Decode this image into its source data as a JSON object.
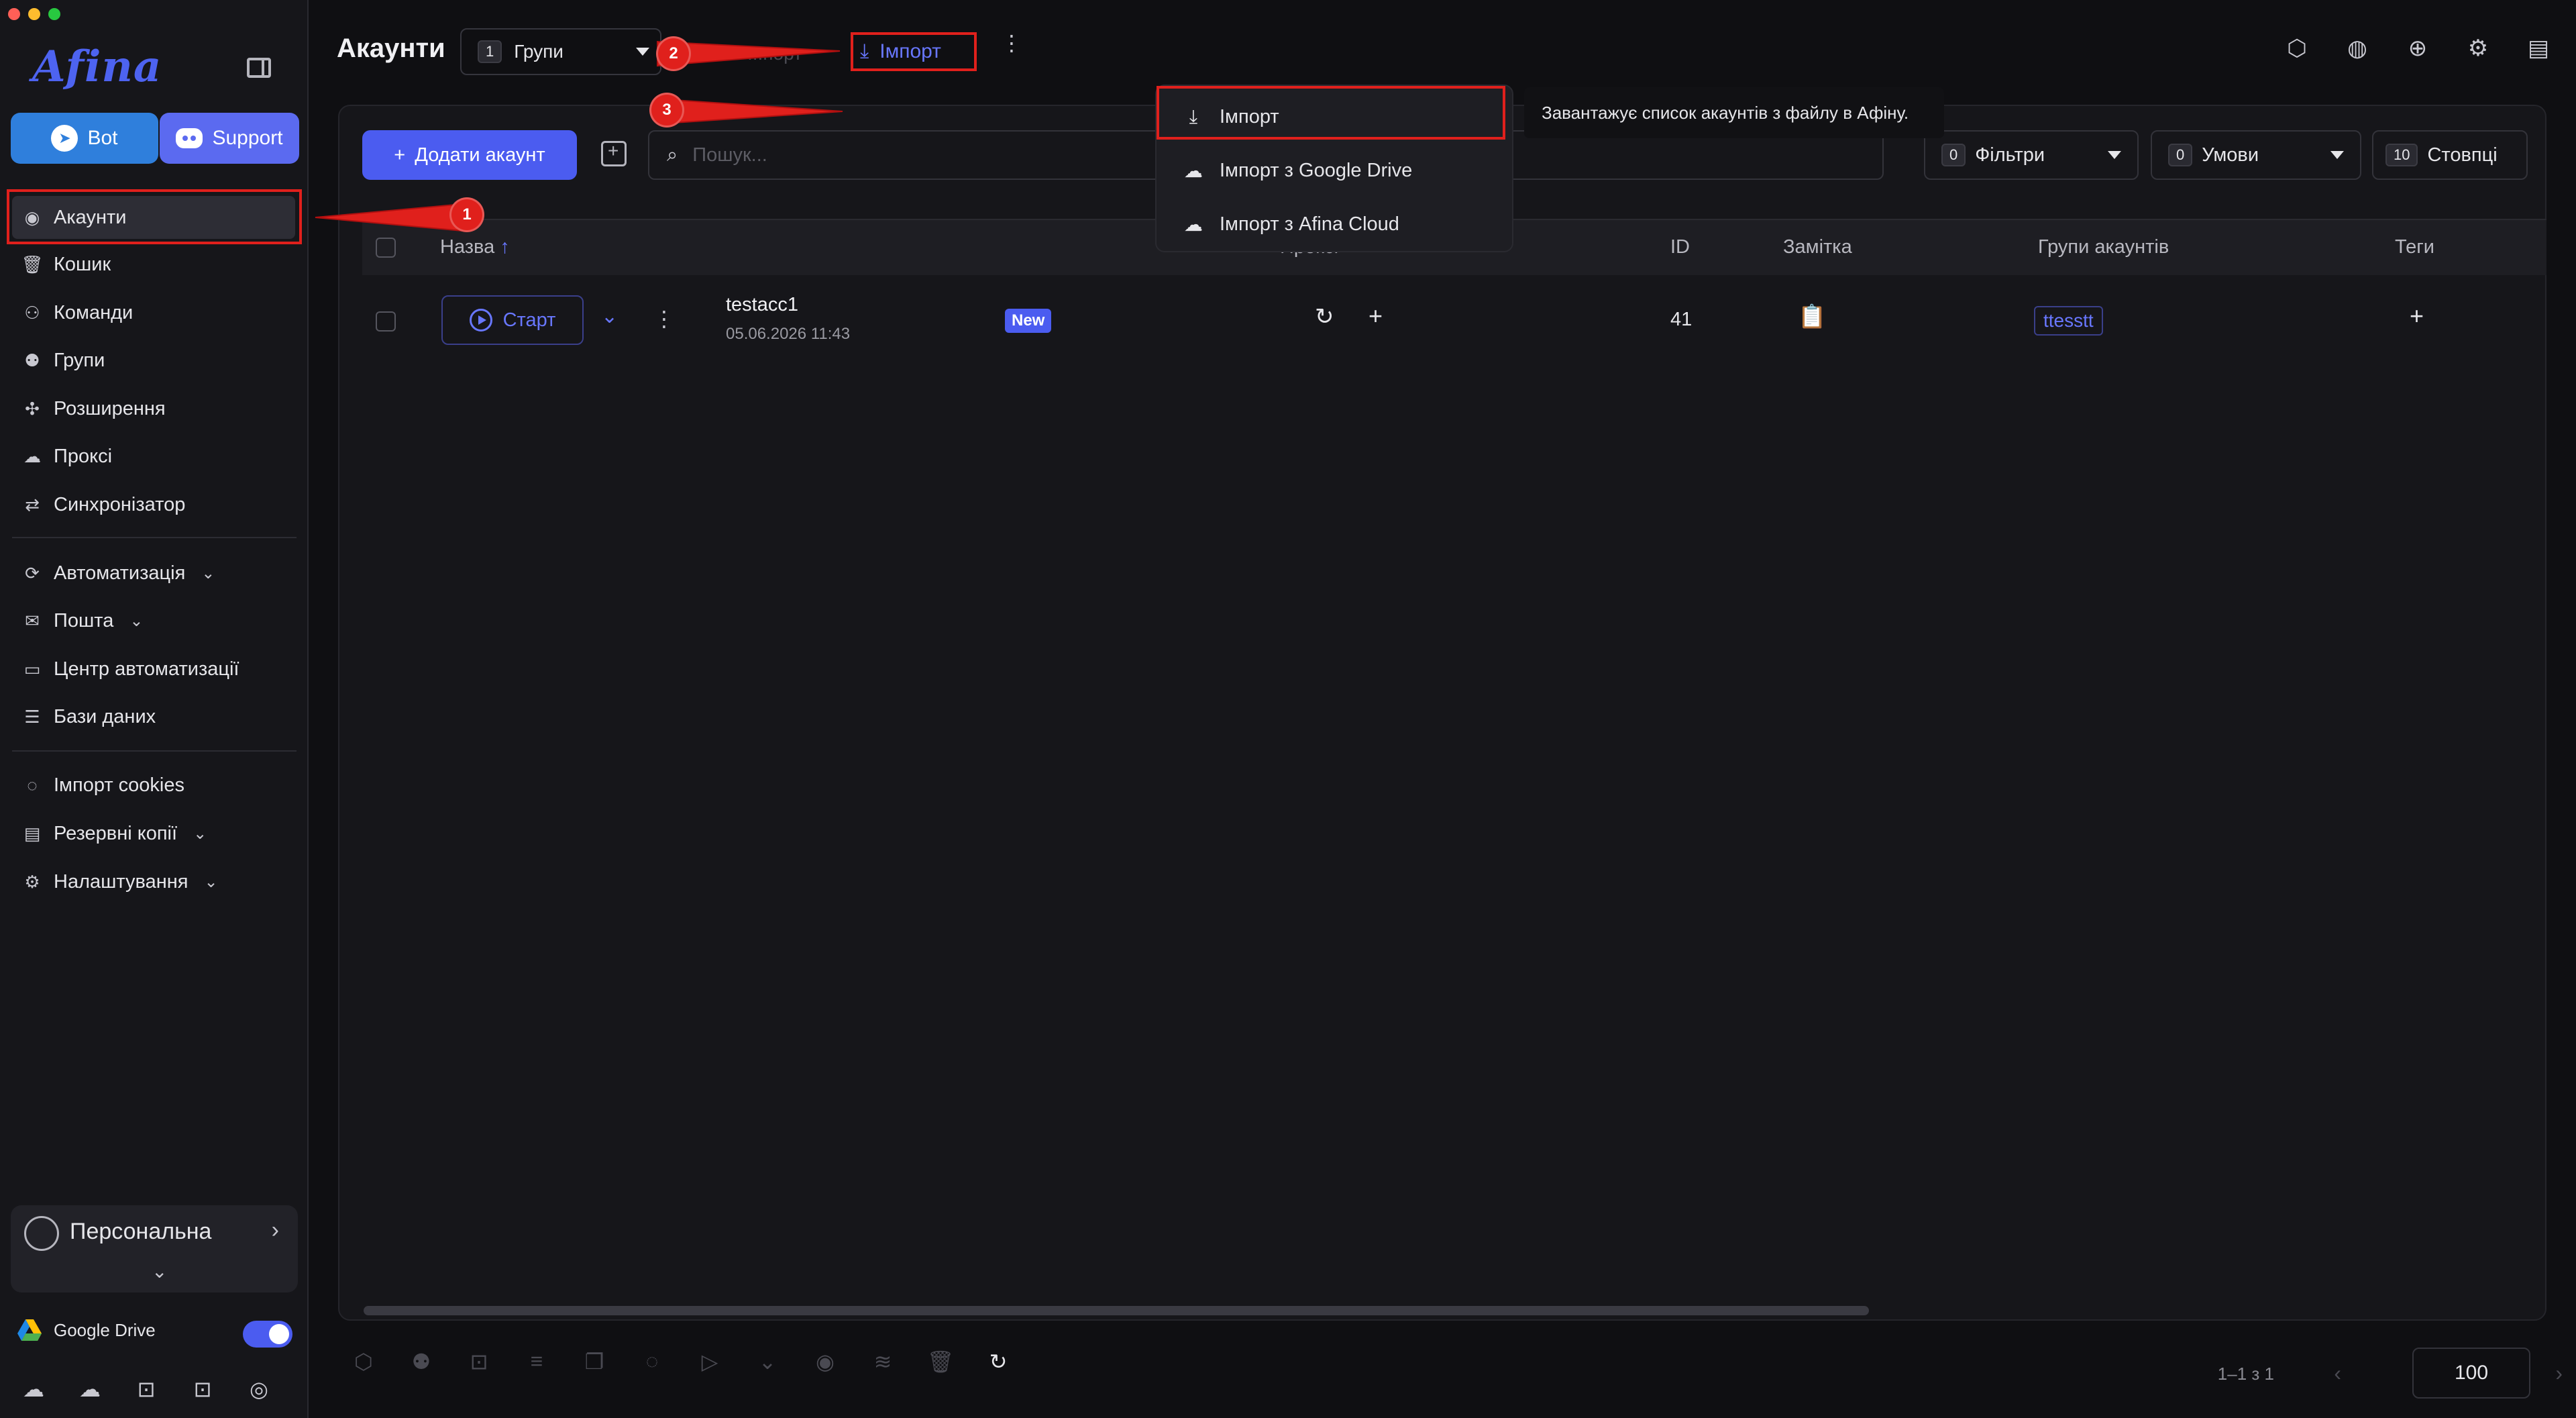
{
  "sidebar": {
    "brand": "Afina",
    "bot_label": "Bot",
    "support_label": "Support",
    "items": [
      {
        "label": "Акаунти"
      },
      {
        "label": "Кошик"
      },
      {
        "label": "Команди"
      },
      {
        "label": "Групи"
      },
      {
        "label": "Розширення"
      },
      {
        "label": "Проксі"
      },
      {
        "label": "Синхронізатор"
      },
      {
        "label": "Автоматизація"
      },
      {
        "label": "Пошта"
      },
      {
        "label": "Центр автоматизації"
      },
      {
        "label": "Бази даних"
      },
      {
        "label": "Імпорт cookies"
      },
      {
        "label": "Резервні копії"
      },
      {
        "label": "Налаштування"
      }
    ],
    "profile_name": "Персональна",
    "gdrive_label": "Google Drive",
    "gdrive_enabled": true
  },
  "header": {
    "title": "Акаунти",
    "groups_count": "1",
    "groups_label": "Групи",
    "ghost_label": "...порт",
    "import_label": "Імпорт"
  },
  "toolbar": {
    "add_label": "Додати акаунт",
    "search_placeholder": "Пошук...",
    "filters_count": "0",
    "filters_label": "Фільтри",
    "conditions_count": "0",
    "conditions_label": "Умови",
    "columns_count": "10",
    "columns_label": "Стовпці"
  },
  "table": {
    "columns": [
      "Назва",
      "Проксі",
      "ID",
      "Замітка",
      "Групи акаунтів",
      "Теги"
    ],
    "rows": [
      {
        "start_label": "Старт",
        "name": "testacc1",
        "date": "05.06.2026 11:43",
        "status": "New",
        "id": "41",
        "group": "ttesstt"
      }
    ]
  },
  "pagination": {
    "range": "1–1 з 1",
    "page_size": "100"
  },
  "import_menu": {
    "items": [
      {
        "label": "Імпорт"
      },
      {
        "label": "Імпорт з Google Drive"
      },
      {
        "label": "Імпорт з Afina Cloud"
      }
    ],
    "tooltip": "Завантажує список акаунтів з файлу в Афіну."
  },
  "callouts": [
    "1",
    "2",
    "3"
  ],
  "colors": {
    "accent": "#4b5cf0",
    "highlight": "#e0201c",
    "bot": "#2f7fdc",
    "support": "#5b6af0"
  }
}
